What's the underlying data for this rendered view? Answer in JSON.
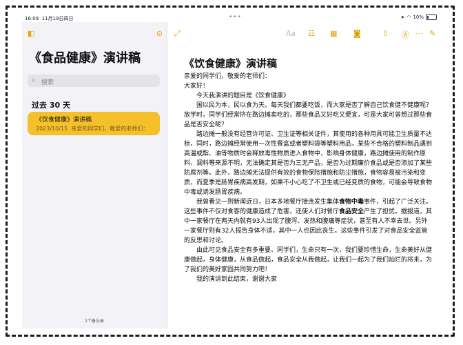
{
  "status": {
    "time": "16:09",
    "date": "11月19日周日",
    "battery": "10%"
  },
  "sidebar": {
    "title": "《食品健康》演讲稿",
    "search_placeholder": "搜索",
    "section": "过去 30 天",
    "note": {
      "title": "《饮食健康》演讲稿",
      "date": "2023/10/15",
      "preview": "亲爱的同学们，敬爱的老师们："
    },
    "count": "1个备忘录"
  },
  "toolbar": {
    "format": "Aa"
  },
  "note": {
    "title": "《饮食健康》演讲稿",
    "greeting1": "亲爱的同学们，敬爱的老师们：",
    "greeting2": "大家好！",
    "p1": "今天我演讲的题目是《饮食健康》",
    "p2": "国以民为本，民以食为天。每天我们都要吃饭，而大家是否了解自己饮食健不健康呢？放学时，同学们经常挤在路边摊卖吃的，那些食品又好吃又便宜，可是大家可曾想过那些食品是否安全呢？",
    "p3": "路边摊一般没有经营许可证、卫生证等相关证件，其使用的各种用具可能卫生质量不达标，同时，路边摊经常使用一次性餐盒或者塑料袋等塑料用品，某些不合格的塑料制品遇到高温或酯、油等物质时会释放毒性物质进入食物中，影响身体健康，路边摊使用的制作原料、调料等来源不明，无法确定其是否为三无产品，是否为过期廉价食品或是否添加了某些防腐剂等。此外，路边摊无法提供有效的食物保险措施和防尘措施，食物容易被污染和变质，而夏季是肠胃疾病高发期，如果不小心吃了不卫生或已经变质的食物，可能会导致食物中毒或诱发肠胃疾病。",
    "p4a": "我曾看见一则新闻近日，日本多地餐厅接连发生集体",
    "p4b": "食物中毒",
    "p4c": "事件，引起了广泛关注。这些事件不仅对食客的健康造成了危害，还使人们对餐厅",
    "p4d": "食品安全",
    "p4e": "产生了担忧。据报道，其中一家餐厅在两天内就有93人出现了腹泻、发热和腹痛等症状，甚至有人不幸去世。另外一家餐厅则有32人报告身体不适，其中一人也因此丧生。这些事件引发了对食品安全监管的反思和讨论。",
    "p5": "由此可见食品安全有多重要。同学们，生命只有一次，我们要珍惜生命，生命美好从健康做起，身体健康，从食品做起，食品安全从我做起，让我们一起为了我们灿烂的将来，为了我们的美好家园共同努力吧！",
    "p6": "我的演讲到此结束，谢谢大家"
  }
}
